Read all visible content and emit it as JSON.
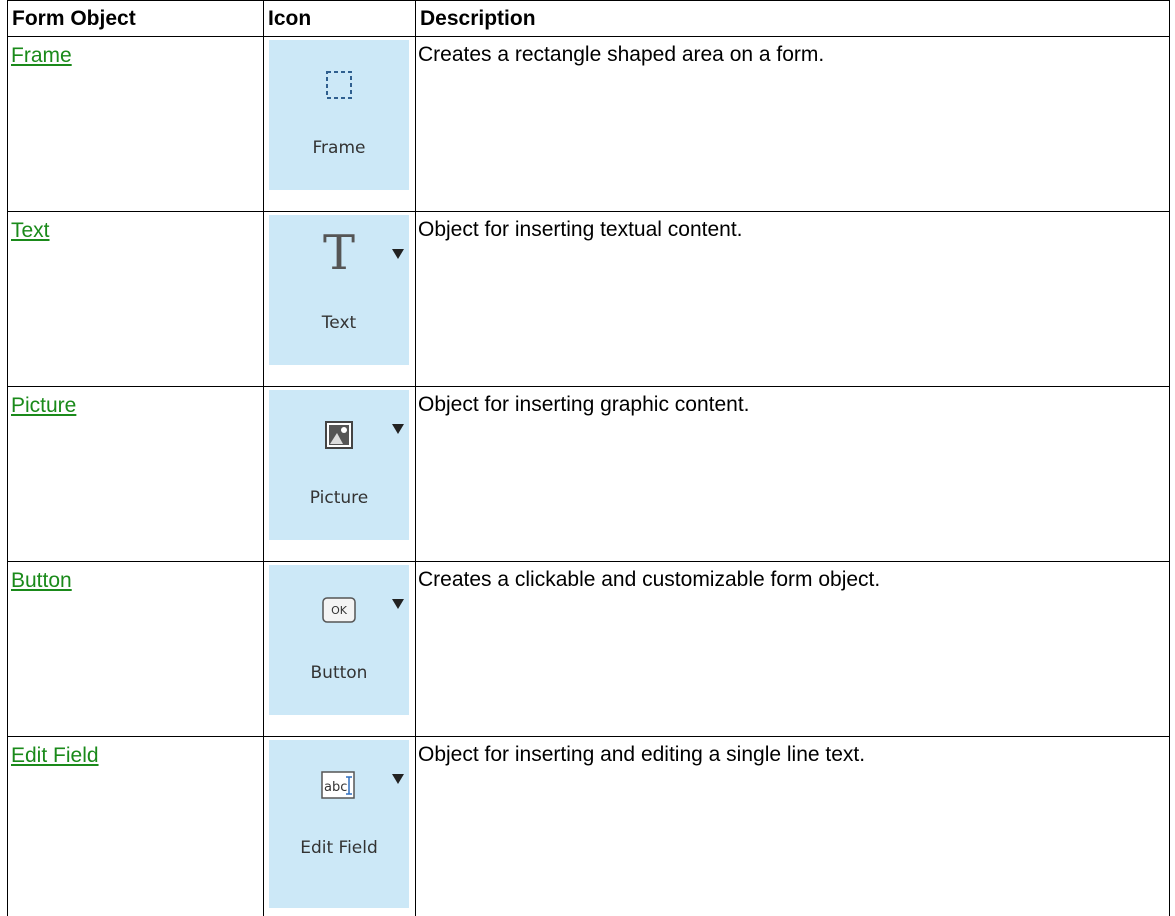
{
  "header": {
    "col_object": "Form Object",
    "col_icon": "Icon",
    "col_description": "Description"
  },
  "rows": [
    {
      "name": "Frame",
      "tile_label": "Frame",
      "icon": "frame-icon",
      "has_dropdown": false,
      "description": "Creates a rectangle shaped area on a form."
    },
    {
      "name": "Text",
      "tile_label": "Text",
      "icon": "text-icon",
      "has_dropdown": true,
      "description": "Object for inserting textual content."
    },
    {
      "name": "Picture",
      "tile_label": "Picture",
      "icon": "picture-icon",
      "has_dropdown": true,
      "description": "Object for inserting graphic content."
    },
    {
      "name": "Button",
      "tile_label": "Button",
      "icon": "button-icon",
      "glyph_text": "OK",
      "has_dropdown": true,
      "description": "Creates a clickable and customizable form object."
    },
    {
      "name": "Edit Field",
      "tile_label": "Edit Field",
      "icon": "edit-field-icon",
      "glyph_text": "abc",
      "has_dropdown": true,
      "description": "Object for inserting and editing a single line text."
    }
  ],
  "colors": {
    "link": "#1a8a1a",
    "tile_background": "#cce8f7",
    "border": "#000000"
  }
}
